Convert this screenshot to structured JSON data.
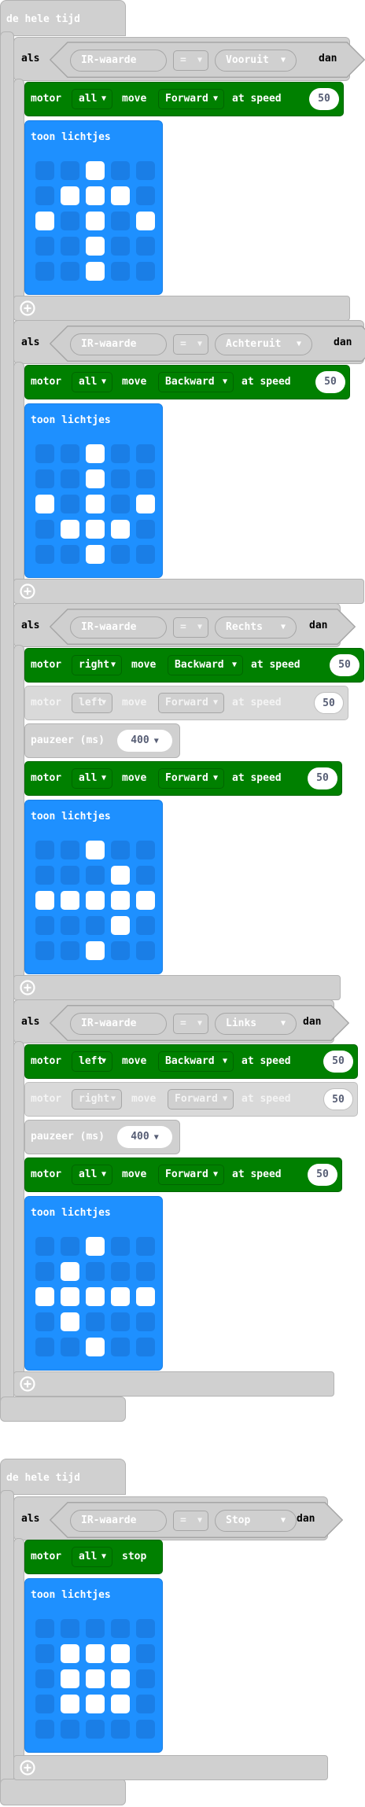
{
  "forever_label": "de hele tijd",
  "if_label": "als",
  "then_label": "dan",
  "ir_label": "IR-waarde",
  "eq_label": "=",
  "show_leds_label": "toon lichtjes",
  "motor_label": "motor",
  "move_label": "move",
  "at_speed_label": "at speed",
  "stop_label": "stop",
  "pause_label": "pauzeer (ms)",
  "colors": {
    "motor": "#008000",
    "leds": "#1e90ff",
    "logic": "#d0d0d0"
  },
  "blocks": [
    {
      "command": "Vooruit",
      "motors": [
        {
          "motor": "all",
          "direction": "Forward",
          "speed": "50",
          "enabled": true
        }
      ],
      "leds": [
        [
          0,
          0,
          1,
          0,
          0
        ],
        [
          0,
          1,
          1,
          1,
          0
        ],
        [
          1,
          0,
          1,
          0,
          1
        ],
        [
          0,
          0,
          1,
          0,
          0
        ],
        [
          0,
          0,
          1,
          0,
          0
        ]
      ]
    },
    {
      "command": "Achteruit",
      "motors": [
        {
          "motor": "all",
          "direction": "Backward",
          "speed": "50",
          "enabled": true
        }
      ],
      "leds": [
        [
          0,
          0,
          1,
          0,
          0
        ],
        [
          0,
          0,
          1,
          0,
          0
        ],
        [
          1,
          0,
          1,
          0,
          1
        ],
        [
          0,
          1,
          1,
          1,
          0
        ],
        [
          0,
          0,
          1,
          0,
          0
        ]
      ]
    },
    {
      "command": "Rechts",
      "motors": [
        {
          "motor": "right",
          "direction": "Backward",
          "speed": "50",
          "enabled": true
        },
        {
          "motor": "left",
          "direction": "Forward",
          "speed": "50",
          "enabled": false
        },
        {
          "motor": "all",
          "direction": "Forward",
          "speed": "50",
          "enabled": true
        }
      ],
      "pause": "400",
      "leds": [
        [
          0,
          0,
          1,
          0,
          0
        ],
        [
          0,
          0,
          0,
          1,
          0
        ],
        [
          1,
          1,
          1,
          1,
          1
        ],
        [
          0,
          0,
          0,
          1,
          0
        ],
        [
          0,
          0,
          1,
          0,
          0
        ]
      ]
    },
    {
      "command": "Links",
      "motors": [
        {
          "motor": "left",
          "direction": "Backward",
          "speed": "50",
          "enabled": true
        },
        {
          "motor": "right",
          "direction": "Forward",
          "speed": "50",
          "enabled": false
        },
        {
          "motor": "all",
          "direction": "Forward",
          "speed": "50",
          "enabled": true
        }
      ],
      "pause": "400",
      "leds": [
        [
          0,
          0,
          1,
          0,
          0
        ],
        [
          0,
          1,
          0,
          0,
          0
        ],
        [
          1,
          1,
          1,
          1,
          1
        ],
        [
          0,
          1,
          0,
          0,
          0
        ],
        [
          0,
          0,
          1,
          0,
          0
        ]
      ]
    },
    {
      "command": "Stop",
      "motors": [
        {
          "motor": "all",
          "enabled": true
        }
      ],
      "leds": [
        [
          0,
          0,
          0,
          0,
          0
        ],
        [
          0,
          1,
          1,
          1,
          0
        ],
        [
          0,
          1,
          1,
          1,
          0
        ],
        [
          0,
          1,
          1,
          1,
          0
        ],
        [
          0,
          0,
          0,
          0,
          0
        ]
      ]
    }
  ]
}
